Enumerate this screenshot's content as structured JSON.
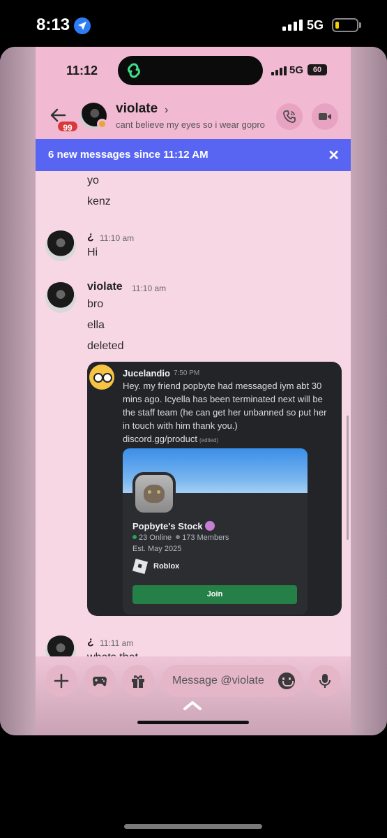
{
  "outer_status": {
    "time": "8:13",
    "network": "5G"
  },
  "inner_status": {
    "time": "11:12",
    "network": "5G",
    "battery": "60"
  },
  "header": {
    "unread_badge": "99",
    "name": "violate",
    "chevron": "›",
    "status": "cant believe my eyes so i wear gopro"
  },
  "banner": {
    "text": "6 new messages since 11:12 AM",
    "close": "✕"
  },
  "messages": {
    "cont_1": "yo",
    "cont_2": "kenz",
    "group_1": {
      "author": "¿",
      "time": "11:10 am",
      "lines": [
        "Hi"
      ]
    },
    "group_2": {
      "author": "violate",
      "time": "11:10 am",
      "lines": [
        "bro",
        "ella",
        "deleted"
      ]
    },
    "group_3": {
      "author": "¿",
      "time": "11:11 am",
      "lines": [
        "whats that"
      ]
    }
  },
  "embed": {
    "author": "Jucelandio",
    "time": "7:50 PM",
    "text": "Hey. my friend popbyte had messaged iym abt 30 mins ago. Icyella has been terminated next will be the staff team (he can get her unbanned so put her in touch with him thank you.)",
    "link": "discord.gg/product",
    "edited": "(edited)",
    "invite": {
      "name": "Popbyte's Stock",
      "online": "23 Online",
      "members": "173 Members",
      "established": "Est. May 2025",
      "game": "Roblox",
      "join_label": "Join"
    }
  },
  "composer": {
    "placeholder": "Message @violate"
  },
  "colors": {
    "banner": "#5865f2",
    "join": "#248046",
    "badge": "#d9393b",
    "screen_bg": "#f8d7e5",
    "header_bg": "#f2b9d2"
  },
  "icons": [
    "location-arrow-icon",
    "signal-icon",
    "battery-icon",
    "link-icon",
    "back-arrow-icon",
    "phone-icon",
    "video-icon",
    "close-icon",
    "plus-icon",
    "gamepad-icon",
    "gift-icon",
    "emoji-icon",
    "microphone-icon",
    "chevron-up-icon"
  ]
}
